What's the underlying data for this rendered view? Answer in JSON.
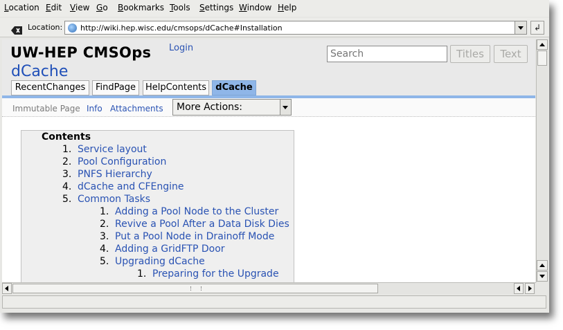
{
  "menu": [
    {
      "label": "Location",
      "accel": "L"
    },
    {
      "label": "Edit",
      "accel": "E"
    },
    {
      "label": "View",
      "accel": "V"
    },
    {
      "label": "Go",
      "accel": "G"
    },
    {
      "label": "Bookmarks",
      "accel": "B"
    },
    {
      "label": "Tools",
      "accel": "T"
    },
    {
      "label": "Settings",
      "accel": "S"
    },
    {
      "label": "Window",
      "accel": "W"
    },
    {
      "label": "Help",
      "accel": "H"
    }
  ],
  "locationbar": {
    "label": "Location:",
    "url": "http://wiki.hep.wisc.edu/cmsops/dCache#Installation",
    "clear_icon": "clear-location-icon",
    "go_icon": "go-enter-icon"
  },
  "header": {
    "site_name": "UW-HEP CMSOps",
    "login": "Login",
    "page_title": "dCache",
    "search_placeholder": "Search",
    "titles_button": "Titles",
    "text_button": "Text"
  },
  "nav_tabs": [
    {
      "label": "RecentChanges",
      "current": false
    },
    {
      "label": "FindPage",
      "current": false
    },
    {
      "label": "HelpContents",
      "current": false
    },
    {
      "label": "dCache",
      "current": true
    }
  ],
  "actions": {
    "immutable": "Immutable Page",
    "info": "Info",
    "attachments": "Attachments",
    "more_actions": "More Actions:"
  },
  "toc": {
    "title": "Contents",
    "items": [
      {
        "num": "1.",
        "text": "Service layout",
        "level": 1
      },
      {
        "num": "2.",
        "text": "Pool Configuration",
        "level": 1
      },
      {
        "num": "3.",
        "text": "PNFS Hierarchy",
        "level": 1
      },
      {
        "num": "4.",
        "text": "dCache and CFEngine",
        "level": 1
      },
      {
        "num": "5.",
        "text": "Common Tasks",
        "level": 1
      },
      {
        "num": "1.",
        "text": "Adding a Pool Node to the Cluster",
        "level": 2
      },
      {
        "num": "2.",
        "text": "Revive a Pool After a Data Disk Dies",
        "level": 2
      },
      {
        "num": "3.",
        "text": "Put a Pool Node in Drainoff Mode",
        "level": 2
      },
      {
        "num": "4.",
        "text": "Adding a GridFTP Door",
        "level": 2
      },
      {
        "num": "5.",
        "text": "Upgrading dCache",
        "level": 2
      },
      {
        "num": "1.",
        "text": "Preparing for the Upgrade",
        "level": 3
      }
    ]
  },
  "colors": {
    "link": "#2952b3",
    "title": "#1f4fb8",
    "tab_current": "#8fb6e8",
    "header_bg": "#e9e9e9",
    "toc_bg": "#efefef"
  }
}
